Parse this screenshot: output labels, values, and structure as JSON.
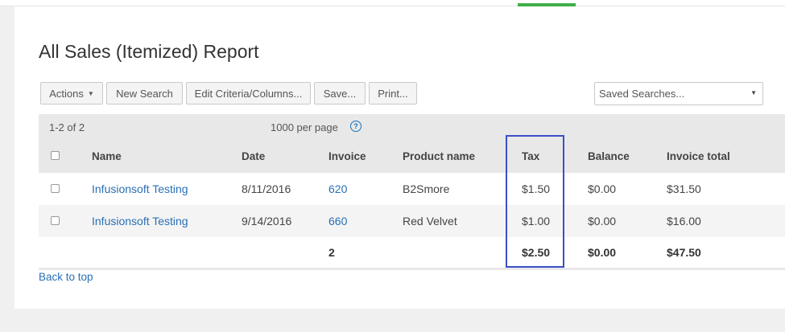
{
  "page": {
    "title": "All Sales (Itemized) Report",
    "accent_color": "#3fae49",
    "link_color": "#2a6fb5",
    "highlight_color": "#3b4fc7"
  },
  "toolbar": {
    "actions_label": "Actions",
    "new_search_label": "New Search",
    "edit_criteria_label": "Edit Criteria/Columns...",
    "save_label": "Save...",
    "print_label": "Print...",
    "saved_searches_value": "Saved Searches..."
  },
  "pagination": {
    "count_text": "1-2 of 2",
    "per_page_text": "1000 per page",
    "help_glyph": "?"
  },
  "table": {
    "columns": [
      "Name",
      "Date",
      "Invoice",
      "Product name",
      "Tax",
      "Balance",
      "Invoice total"
    ],
    "rows": [
      {
        "name": "Infusionsoft Testing",
        "date": "8/11/2016",
        "invoice": "620",
        "product": "B2Smore",
        "tax": "$1.50",
        "balance": "$0.00",
        "total": "$31.50"
      },
      {
        "name": "Infusionsoft Testing",
        "date": "9/14/2016",
        "invoice": "660",
        "product": "Red Velvet",
        "tax": "$1.00",
        "balance": "$0.00",
        "total": "$16.00"
      }
    ],
    "totals": {
      "invoice": "2",
      "tax": "$2.50",
      "balance": "$0.00",
      "total": "$47.50"
    }
  },
  "footer": {
    "back_to_top": "Back to top"
  }
}
